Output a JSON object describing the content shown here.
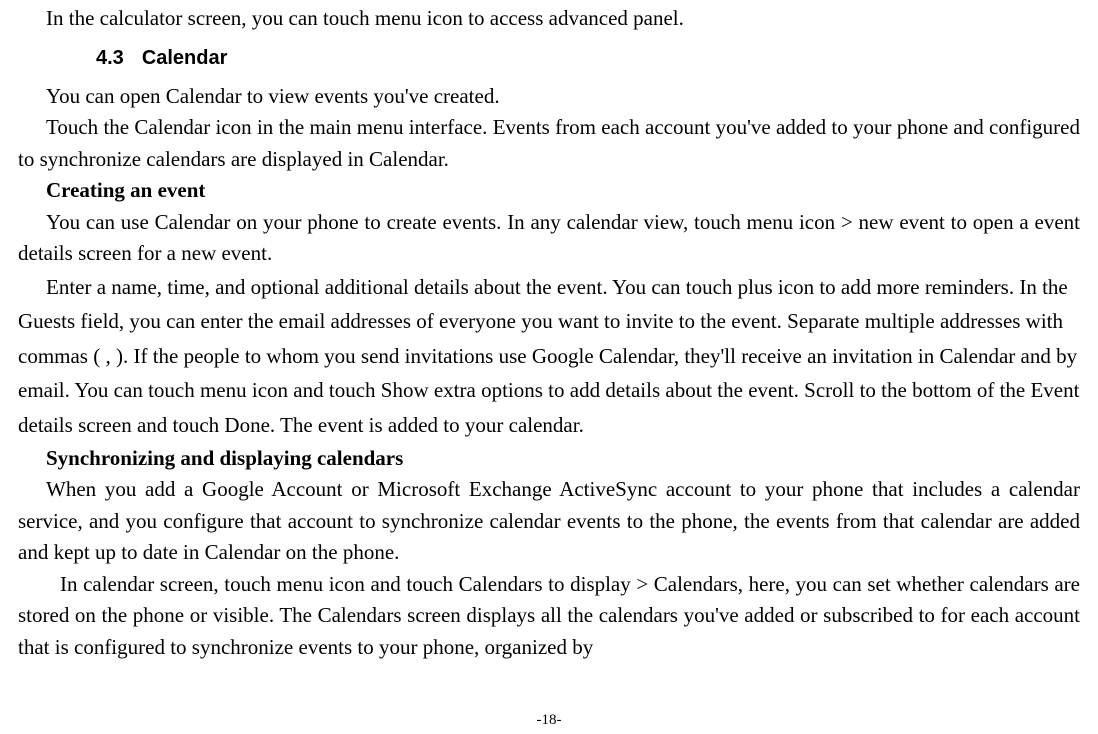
{
  "intro_line": "In the calculator screen, you can touch menu icon to access advanced panel.",
  "section": {
    "number": "4.3",
    "title": "Calendar"
  },
  "p1": "You can open Calendar to view events you've created.",
  "p2": "Touch the Calendar icon in the main menu interface. Events from each account you've added to your phone and configured to synchronize calendars are displayed in Calendar.",
  "h1": "Creating an event",
  "p3": "You can use Calendar on your phone to create events. In any calendar view, touch menu icon > new event to open a event details screen for a new event.",
  "p4": "Enter a name, time, and optional additional details about the event. You can touch plus icon to add more reminders. In the Guests field, you can enter the email addresses of everyone you want to invite to the event. Separate multiple addresses with commas ( , ). If the people to whom you send invitations use Google Calendar, they'll receive an invitation in Calendar and by email. You can touch menu icon and touch Show extra options to add details about the event. Scroll to the bottom of the Event details screen and touch Done. The event is added to your calendar.",
  "h2": "Synchronizing and displaying calendars",
  "p5": "When you add a Google Account or Microsoft Exchange ActiveSync account to your phone that includes a calendar service, and you configure that account to synchronize calendar events to the phone, the events from that calendar are added and kept up to date in Calendar on the phone.",
  "p6": "In calendar screen, touch menu icon and touch Calendars to display > Calendars, here, you can set whether calendars are stored on the phone or visible. The Calendars screen displays all the calendars you've added or subscribed to for each account that is configured to synchronize events to your phone, organized by",
  "page_number": "-18-"
}
